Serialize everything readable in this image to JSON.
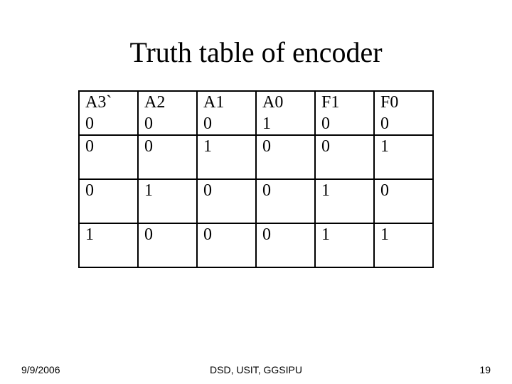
{
  "title": "Truth table of encoder",
  "table": {
    "header_labels": [
      "A3`",
      "A2",
      "A1",
      "A0",
      "F1",
      "F0"
    ],
    "header_values": [
      "0",
      "0",
      "0",
      "1",
      "0",
      "0"
    ],
    "rows": [
      [
        "0",
        "0",
        "1",
        "0",
        "0",
        "1"
      ],
      [
        "0",
        "1",
        "0",
        "0",
        "1",
        "0"
      ],
      [
        "1",
        "0",
        "0",
        "0",
        "1",
        "1"
      ]
    ]
  },
  "footer": {
    "date": "9/9/2006",
    "center": "DSD, USIT, GGSIPU",
    "page": "19"
  },
  "chart_data": {
    "type": "table",
    "title": "Truth table of encoder",
    "columns": [
      "A3`",
      "A2",
      "A1",
      "A0",
      "F1",
      "F0"
    ],
    "rows": [
      [
        0,
        0,
        0,
        1,
        0,
        0
      ],
      [
        0,
        0,
        1,
        0,
        0,
        1
      ],
      [
        0,
        1,
        0,
        0,
        1,
        0
      ],
      [
        1,
        0,
        0,
        0,
        1,
        1
      ]
    ]
  }
}
